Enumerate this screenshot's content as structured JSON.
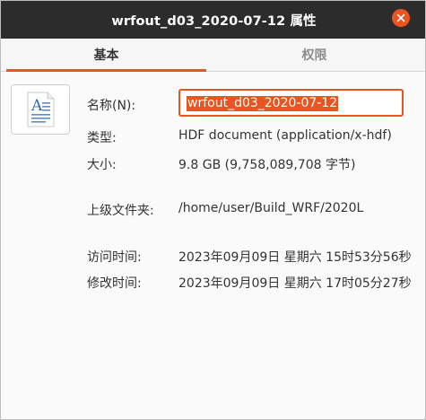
{
  "window": {
    "title": "wrfout_d03_2020-07-12 属性",
    "close_icon": "close-icon"
  },
  "tabs": [
    {
      "label": "基本",
      "active": true
    },
    {
      "label": "权限",
      "active": false
    }
  ],
  "accent_color": "#e95420",
  "file_icon": "text-document-icon",
  "fields": {
    "name_label": "名称(N):",
    "name_value": "wrfout_d03_2020-07-12",
    "type_label": "类型:",
    "type_value": "HDF document (application/x-hdf)",
    "size_label": "大小:",
    "size_value": "9.8 GB (9,758,089,708 字节)",
    "parent_label": "上级文件夹:",
    "parent_value": "/home/user/Build_WRF/2020L",
    "accessed_label": "访问时间:",
    "accessed_value": "2023年09月09日 星期六 15时53分56秒",
    "modified_label": "修改时间:",
    "modified_value": "2023年09月09日 星期六 17时05分27秒"
  }
}
